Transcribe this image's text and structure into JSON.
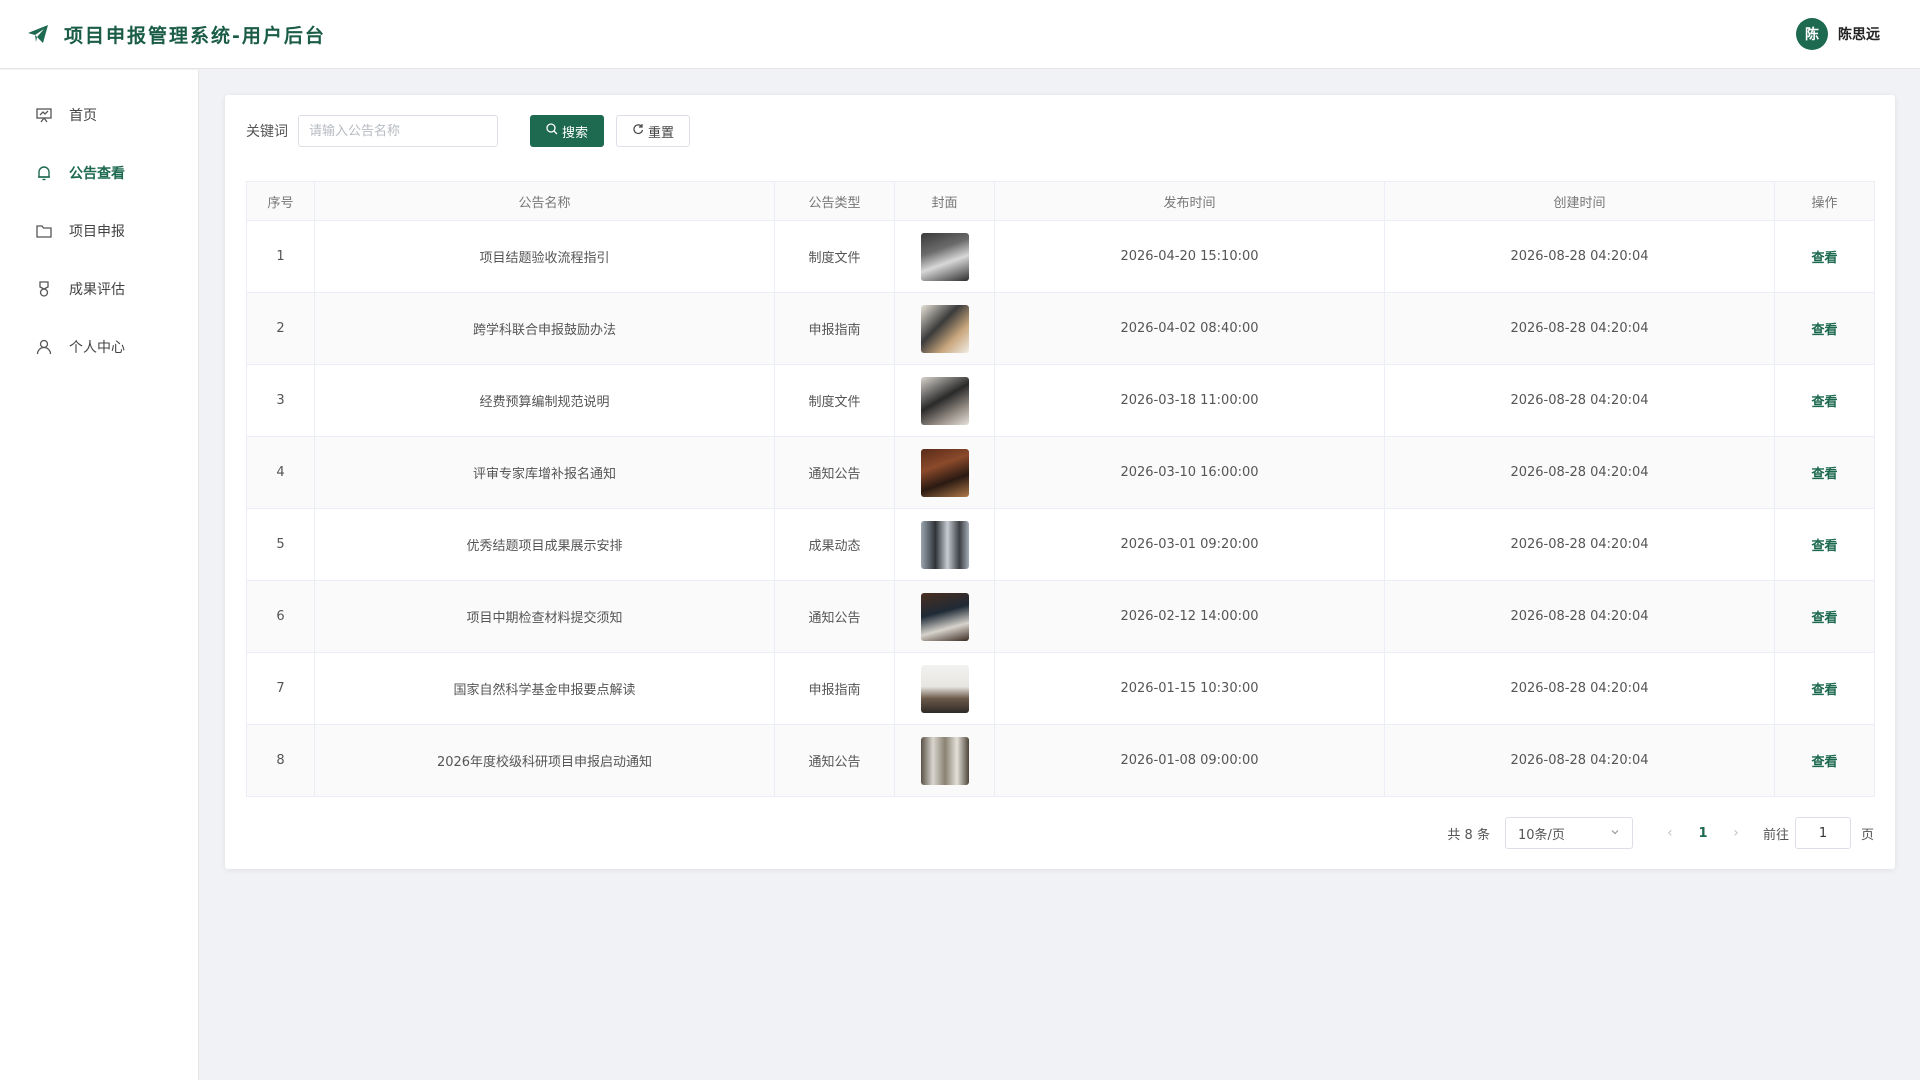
{
  "app": {
    "title": "项目申报管理系统-用户后台"
  },
  "user": {
    "avatar_text": "陈",
    "name": "陈思远"
  },
  "sidebar": {
    "items": [
      {
        "label": "首页",
        "icon": "presentation-icon"
      },
      {
        "label": "公告查看",
        "icon": "bell-icon",
        "active": true
      },
      {
        "label": "项目申报",
        "icon": "folder-icon"
      },
      {
        "label": "成果评估",
        "icon": "medal-icon"
      },
      {
        "label": "个人中心",
        "icon": "user-icon"
      }
    ]
  },
  "search": {
    "label": "关键词",
    "placeholder": "请输入公告名称",
    "value": "",
    "search_button": "搜索",
    "reset_button": "重置"
  },
  "table": {
    "columns": [
      "序号",
      "公告名称",
      "公告类型",
      "封面",
      "发布时间",
      "创建时间",
      "操作"
    ],
    "rows": [
      {
        "no": "1",
        "name": "项目结题验收流程指引",
        "type": "制度文件",
        "published": "2026-04-20 15:10:00",
        "created": "2026-08-28 04:20:04",
        "action": "查看"
      },
      {
        "no": "2",
        "name": "跨学科联合申报鼓励办法",
        "type": "申报指南",
        "published": "2026-04-02 08:40:00",
        "created": "2026-08-28 04:20:04",
        "action": "查看"
      },
      {
        "no": "3",
        "name": "经费预算编制规范说明",
        "type": "制度文件",
        "published": "2026-03-18 11:00:00",
        "created": "2026-08-28 04:20:04",
        "action": "查看"
      },
      {
        "no": "4",
        "name": "评审专家库增补报名通知",
        "type": "通知公告",
        "published": "2026-03-10 16:00:00",
        "created": "2026-08-28 04:20:04",
        "action": "查看"
      },
      {
        "no": "5",
        "name": "优秀结题项目成果展示安排",
        "type": "成果动态",
        "published": "2026-03-01 09:20:00",
        "created": "2026-08-28 04:20:04",
        "action": "查看"
      },
      {
        "no": "6",
        "name": "项目中期检查材料提交须知",
        "type": "通知公告",
        "published": "2026-02-12 14:00:00",
        "created": "2026-08-28 04:20:04",
        "action": "查看"
      },
      {
        "no": "7",
        "name": "国家自然科学基金申报要点解读",
        "type": "申报指南",
        "published": "2026-01-15 10:30:00",
        "created": "2026-08-28 04:20:04",
        "action": "查看"
      },
      {
        "no": "8",
        "name": "2026年度校级科研项目申报启动通知",
        "type": "通知公告",
        "published": "2026-01-08 09:00:00",
        "created": "2026-08-28 04:20:04",
        "action": "查看"
      }
    ]
  },
  "pagination": {
    "total": "共 8 条",
    "page_size": "10条/页",
    "current_page": "1",
    "goto_label": "前往",
    "goto_value": "1",
    "goto_suffix": "页"
  },
  "colors": {
    "accent": "#1e6a50"
  }
}
